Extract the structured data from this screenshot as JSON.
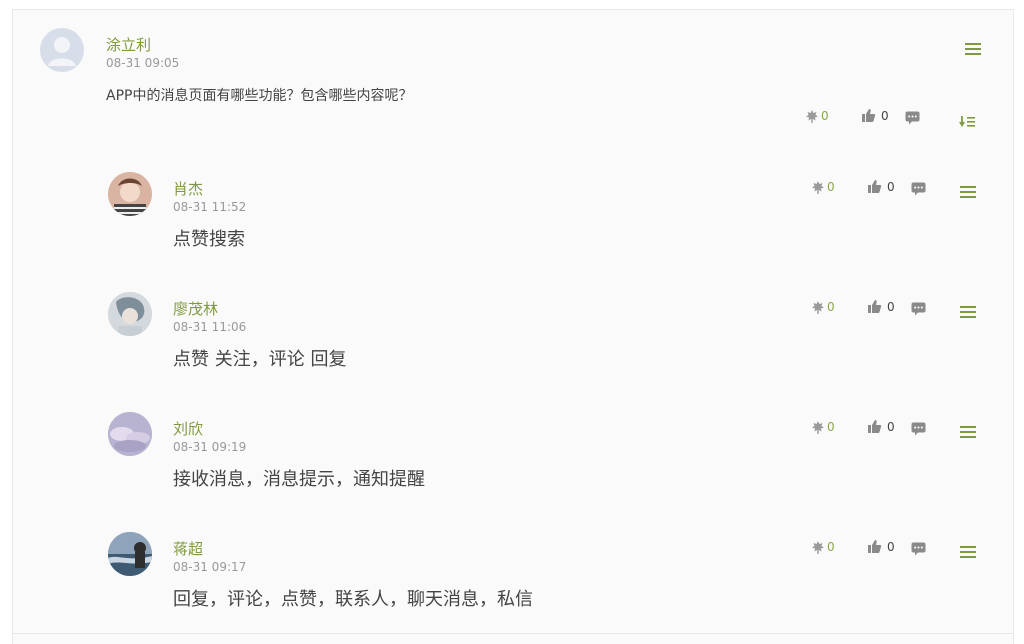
{
  "post": {
    "author": "涂立利",
    "time": "08-31 09:05",
    "question": "APP中的消息页面有哪些功能？包含哪些内容呢？",
    "flowers": "0",
    "likes": "0"
  },
  "replies": [
    {
      "author": "肖杰",
      "time": "08-31 11:52",
      "content": "点赞搜索",
      "flowers": "0",
      "likes": "0"
    },
    {
      "author": "廖茂林",
      "time": "08-31 11:06",
      "content": "点赞 关注，评论 回复",
      "flowers": "0",
      "likes": "0"
    },
    {
      "author": "刘欣",
      "time": "08-31 09:19",
      "content": "接收消息，消息提示，通知提醒",
      "flowers": "0",
      "likes": "0"
    },
    {
      "author": "蒋超",
      "time": "08-31 09:17",
      "content": "回复，评论，点赞，联系人，聊天消息，私信",
      "flowers": "0",
      "likes": "0"
    }
  ],
  "icons": {
    "menu": "menu-icon",
    "flower": "flower-icon",
    "like": "thumbs-up-icon",
    "comment": "comment-icon",
    "sort": "sort-icon"
  },
  "colors": {
    "accent": "#7f9a3e",
    "icon_gray": "#999999",
    "text": "#444444",
    "muted": "#999999"
  }
}
